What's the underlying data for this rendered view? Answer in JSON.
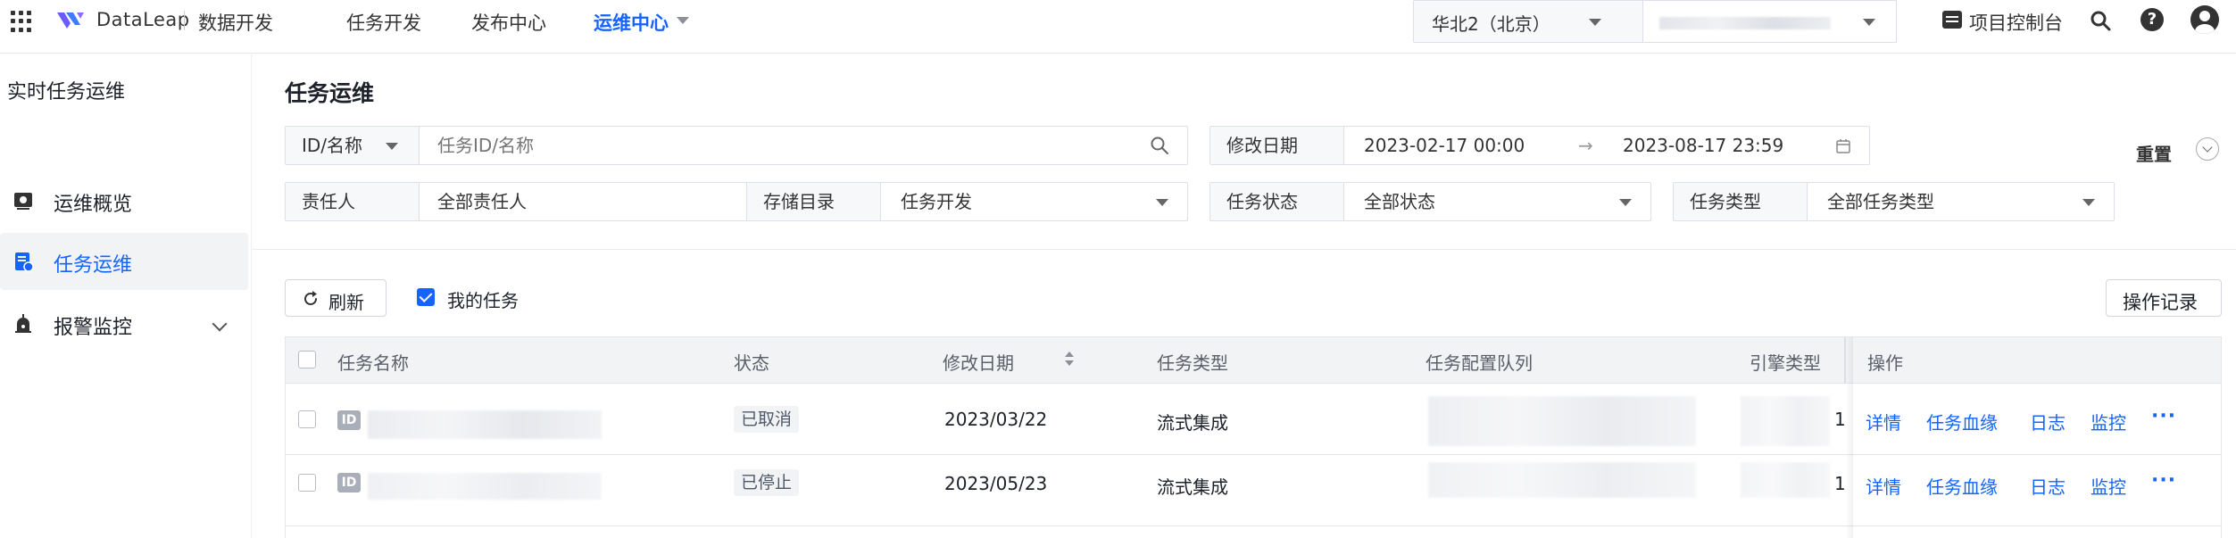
{
  "topnav": {
    "brand": "DataLeap",
    "brand_sub": "数据开发",
    "nav": [
      "任务开发",
      "发布中心",
      "运维中心"
    ],
    "active_nav": "运维中心",
    "region": "华北2（北京）",
    "console": "项目控制台",
    "help": "?"
  },
  "sidebar": {
    "title": "实时任务运维",
    "items": [
      {
        "label": "运维概览",
        "icon": "overview-icon"
      },
      {
        "label": "任务运维",
        "icon": "task-ops-icon",
        "active": true
      },
      {
        "label": "报警监控",
        "icon": "alarm-icon"
      }
    ]
  },
  "main": {
    "title": "任务运维",
    "filters": {
      "id_name_label": "ID/名称",
      "id_name_placeholder": "任务ID/名称",
      "modify_date_label": "修改日期",
      "date_start": "2023-02-17 00:00",
      "date_arrow": "→",
      "date_end": "2023-08-17 23:59",
      "owner_label": "责任人",
      "owner_value": "全部责任人",
      "storage_label": "存储目录",
      "storage_value": "任务开发",
      "status_label": "任务状态",
      "status_value": "全部状态",
      "type_label": "任务类型",
      "type_value": "全部任务类型",
      "reset": "重置"
    },
    "toolbar": {
      "refresh": "刷新",
      "my_tasks": "我的任务",
      "my_tasks_checked": true,
      "op_log": "操作记录"
    },
    "table": {
      "columns": [
        "任务名称",
        "状态",
        "修改日期",
        "任务类型",
        "任务配置队列",
        "引擎类型",
        "操作"
      ],
      "rows": [
        {
          "id_tag": "ID",
          "status": "已取消",
          "date": "2023/03/22",
          "type": "流式集成",
          "engine_suffix": "1",
          "actions": [
            "详情",
            "任务血缘",
            "日志",
            "监控"
          ],
          "more": "···"
        },
        {
          "id_tag": "ID",
          "status": "已停止",
          "date": "2023/05/23",
          "type": "流式集成",
          "engine_suffix": "1",
          "actions": [
            "详情",
            "任务血缘",
            "日志",
            "监控"
          ],
          "more": "···"
        }
      ]
    }
  },
  "colors": {
    "accent": "#1664ff",
    "header_bg": "#f2f3f5",
    "label_bg": "#f7f8fa"
  }
}
